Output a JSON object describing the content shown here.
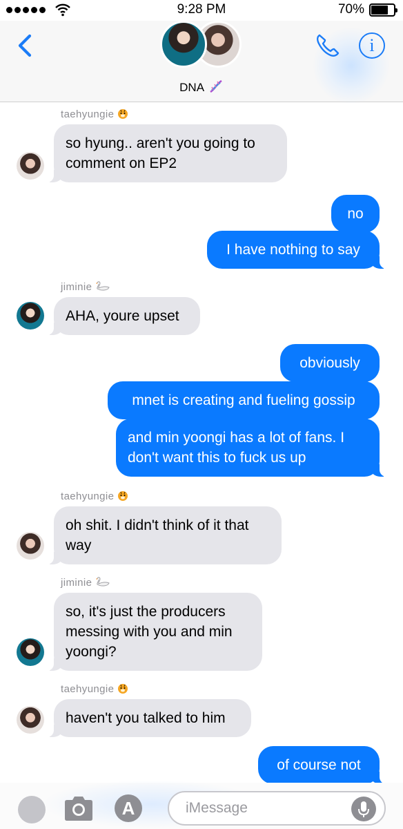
{
  "status_bar": {
    "time": "9:28 PM",
    "battery": "70%",
    "battery_level": 0.7
  },
  "header": {
    "group_name": "DNA",
    "group_emoji": "dna",
    "icons": [
      "back-chevron",
      "phone",
      "info"
    ],
    "accent": "#1b7cf7"
  },
  "messages": [
    {
      "side": "in",
      "sender": "taehyungie",
      "sender_emoji": "tiger-face",
      "avatar": "taehyung",
      "lines": [
        "so hyung.. aren't you going to",
        "comment on EP2"
      ]
    },
    {
      "side": "out",
      "lines": [
        "no"
      ]
    },
    {
      "side": "out",
      "lines": [
        "I have nothing to say"
      ]
    },
    {
      "side": "in",
      "sender": "jiminie",
      "sender_emoji": "swan",
      "avatar": "jimin",
      "lines": [
        "AHA, youre upset"
      ]
    },
    {
      "side": "out",
      "lines": [
        "obviously"
      ]
    },
    {
      "side": "out",
      "lines": [
        "mnet is creating and fueling gossip"
      ]
    },
    {
      "side": "out",
      "lines": [
        "and min yoongi has a lot of fans. I",
        "don't want this to fuck us up"
      ]
    },
    {
      "side": "in",
      "sender": "taehyungie",
      "sender_emoji": "tiger-face",
      "avatar": "taehyung",
      "lines": [
        "oh shit. I didn't think of it that",
        "way"
      ]
    },
    {
      "side": "in",
      "sender": "jiminie",
      "sender_emoji": "swan",
      "avatar": "jimin",
      "lines": [
        "so, it's just the producers",
        "messing with you and min",
        "yoongi?"
      ]
    },
    {
      "side": "in",
      "sender": "taehyungie",
      "sender_emoji": "tiger-face",
      "avatar": "taehyung",
      "lines": [
        "haven't you talked to him"
      ]
    },
    {
      "side": "out",
      "lines": [
        "of course not"
      ]
    }
  ],
  "input_bar": {
    "placeholder": "iMessage",
    "icons": [
      "dot",
      "camera",
      "app-store",
      "microphone"
    ]
  },
  "colors": {
    "outgoing": "#0a7aff",
    "incoming": "#e5e5ea",
    "sender_label": "#8e8e93"
  }
}
